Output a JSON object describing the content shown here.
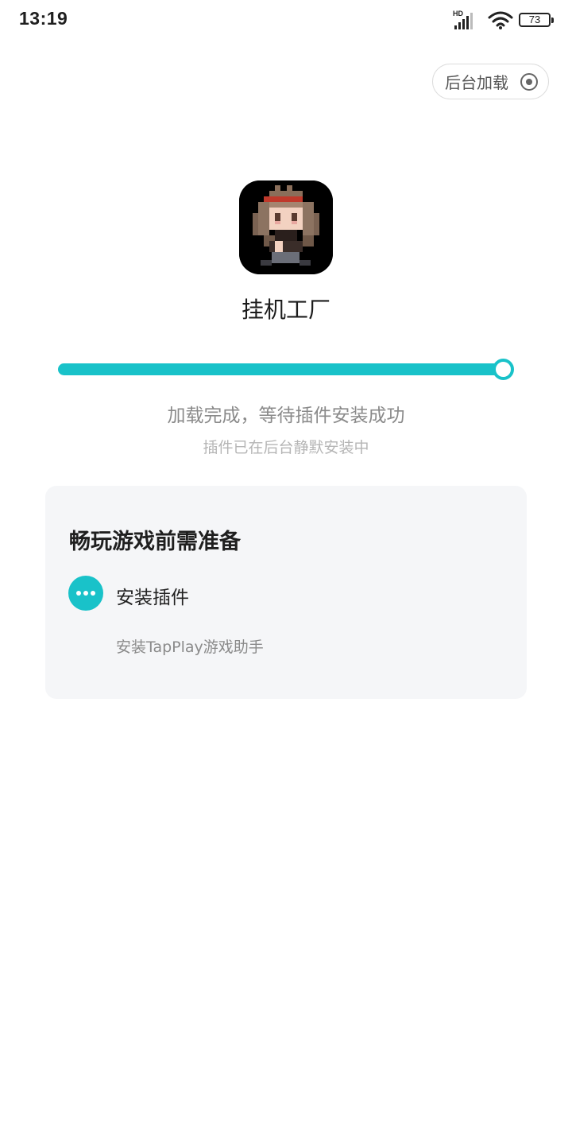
{
  "status_bar": {
    "time": "13:19",
    "network_label": "HD",
    "battery": "73",
    "icons": [
      "signal-icon",
      "wifi-icon",
      "battery-icon"
    ]
  },
  "background_load": {
    "label": "后台加载",
    "icon": "target-icon"
  },
  "app": {
    "name": "挂机工厂",
    "icon": "pixel-character-app-icon"
  },
  "progress": {
    "percent": 100,
    "color": "#19c2c9",
    "status": "加载完成，等待插件安装成功",
    "sub_status": "插件已在后台静默安装中"
  },
  "prep": {
    "title": "畅玩游戏前需准备",
    "steps": [
      {
        "icon": "more-dots-icon",
        "title": "安装插件",
        "desc": "安装TapPlay游戏助手"
      }
    ]
  }
}
